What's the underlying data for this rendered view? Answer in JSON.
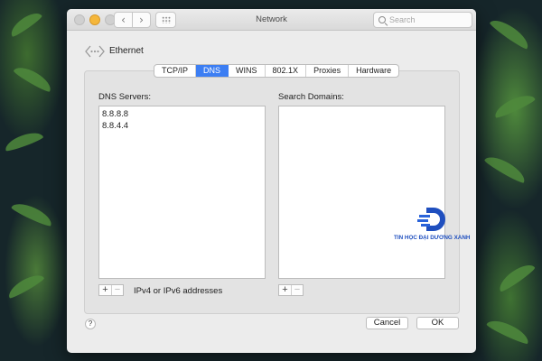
{
  "window": {
    "title": "Network"
  },
  "toolbar": {
    "back": "‹",
    "forward": "›",
    "search_placeholder": "Search"
  },
  "service": {
    "name": "Ethernet"
  },
  "tabs": [
    {
      "label": "TCP/IP",
      "active": false
    },
    {
      "label": "DNS",
      "active": true
    },
    {
      "label": "WINS",
      "active": false
    },
    {
      "label": "802.1X",
      "active": false
    },
    {
      "label": "Proxies",
      "active": false
    },
    {
      "label": "Hardware",
      "active": false
    }
  ],
  "dns": {
    "label": "DNS Servers:",
    "entries": [
      "8.8.8.8",
      "8.8.4.4"
    ],
    "hint": "IPv4 or IPv6 addresses"
  },
  "search_domains": {
    "label": "Search Domains:",
    "entries": []
  },
  "buttons": {
    "plus": "+",
    "minus": "−",
    "help": "?",
    "cancel": "Cancel",
    "ok": "OK"
  },
  "watermark": {
    "text": "TIN HỌC ĐẠI DƯƠNG XANH"
  },
  "colors": {
    "accent": "#3c7ef3",
    "watermark": "#1f4fbf"
  }
}
